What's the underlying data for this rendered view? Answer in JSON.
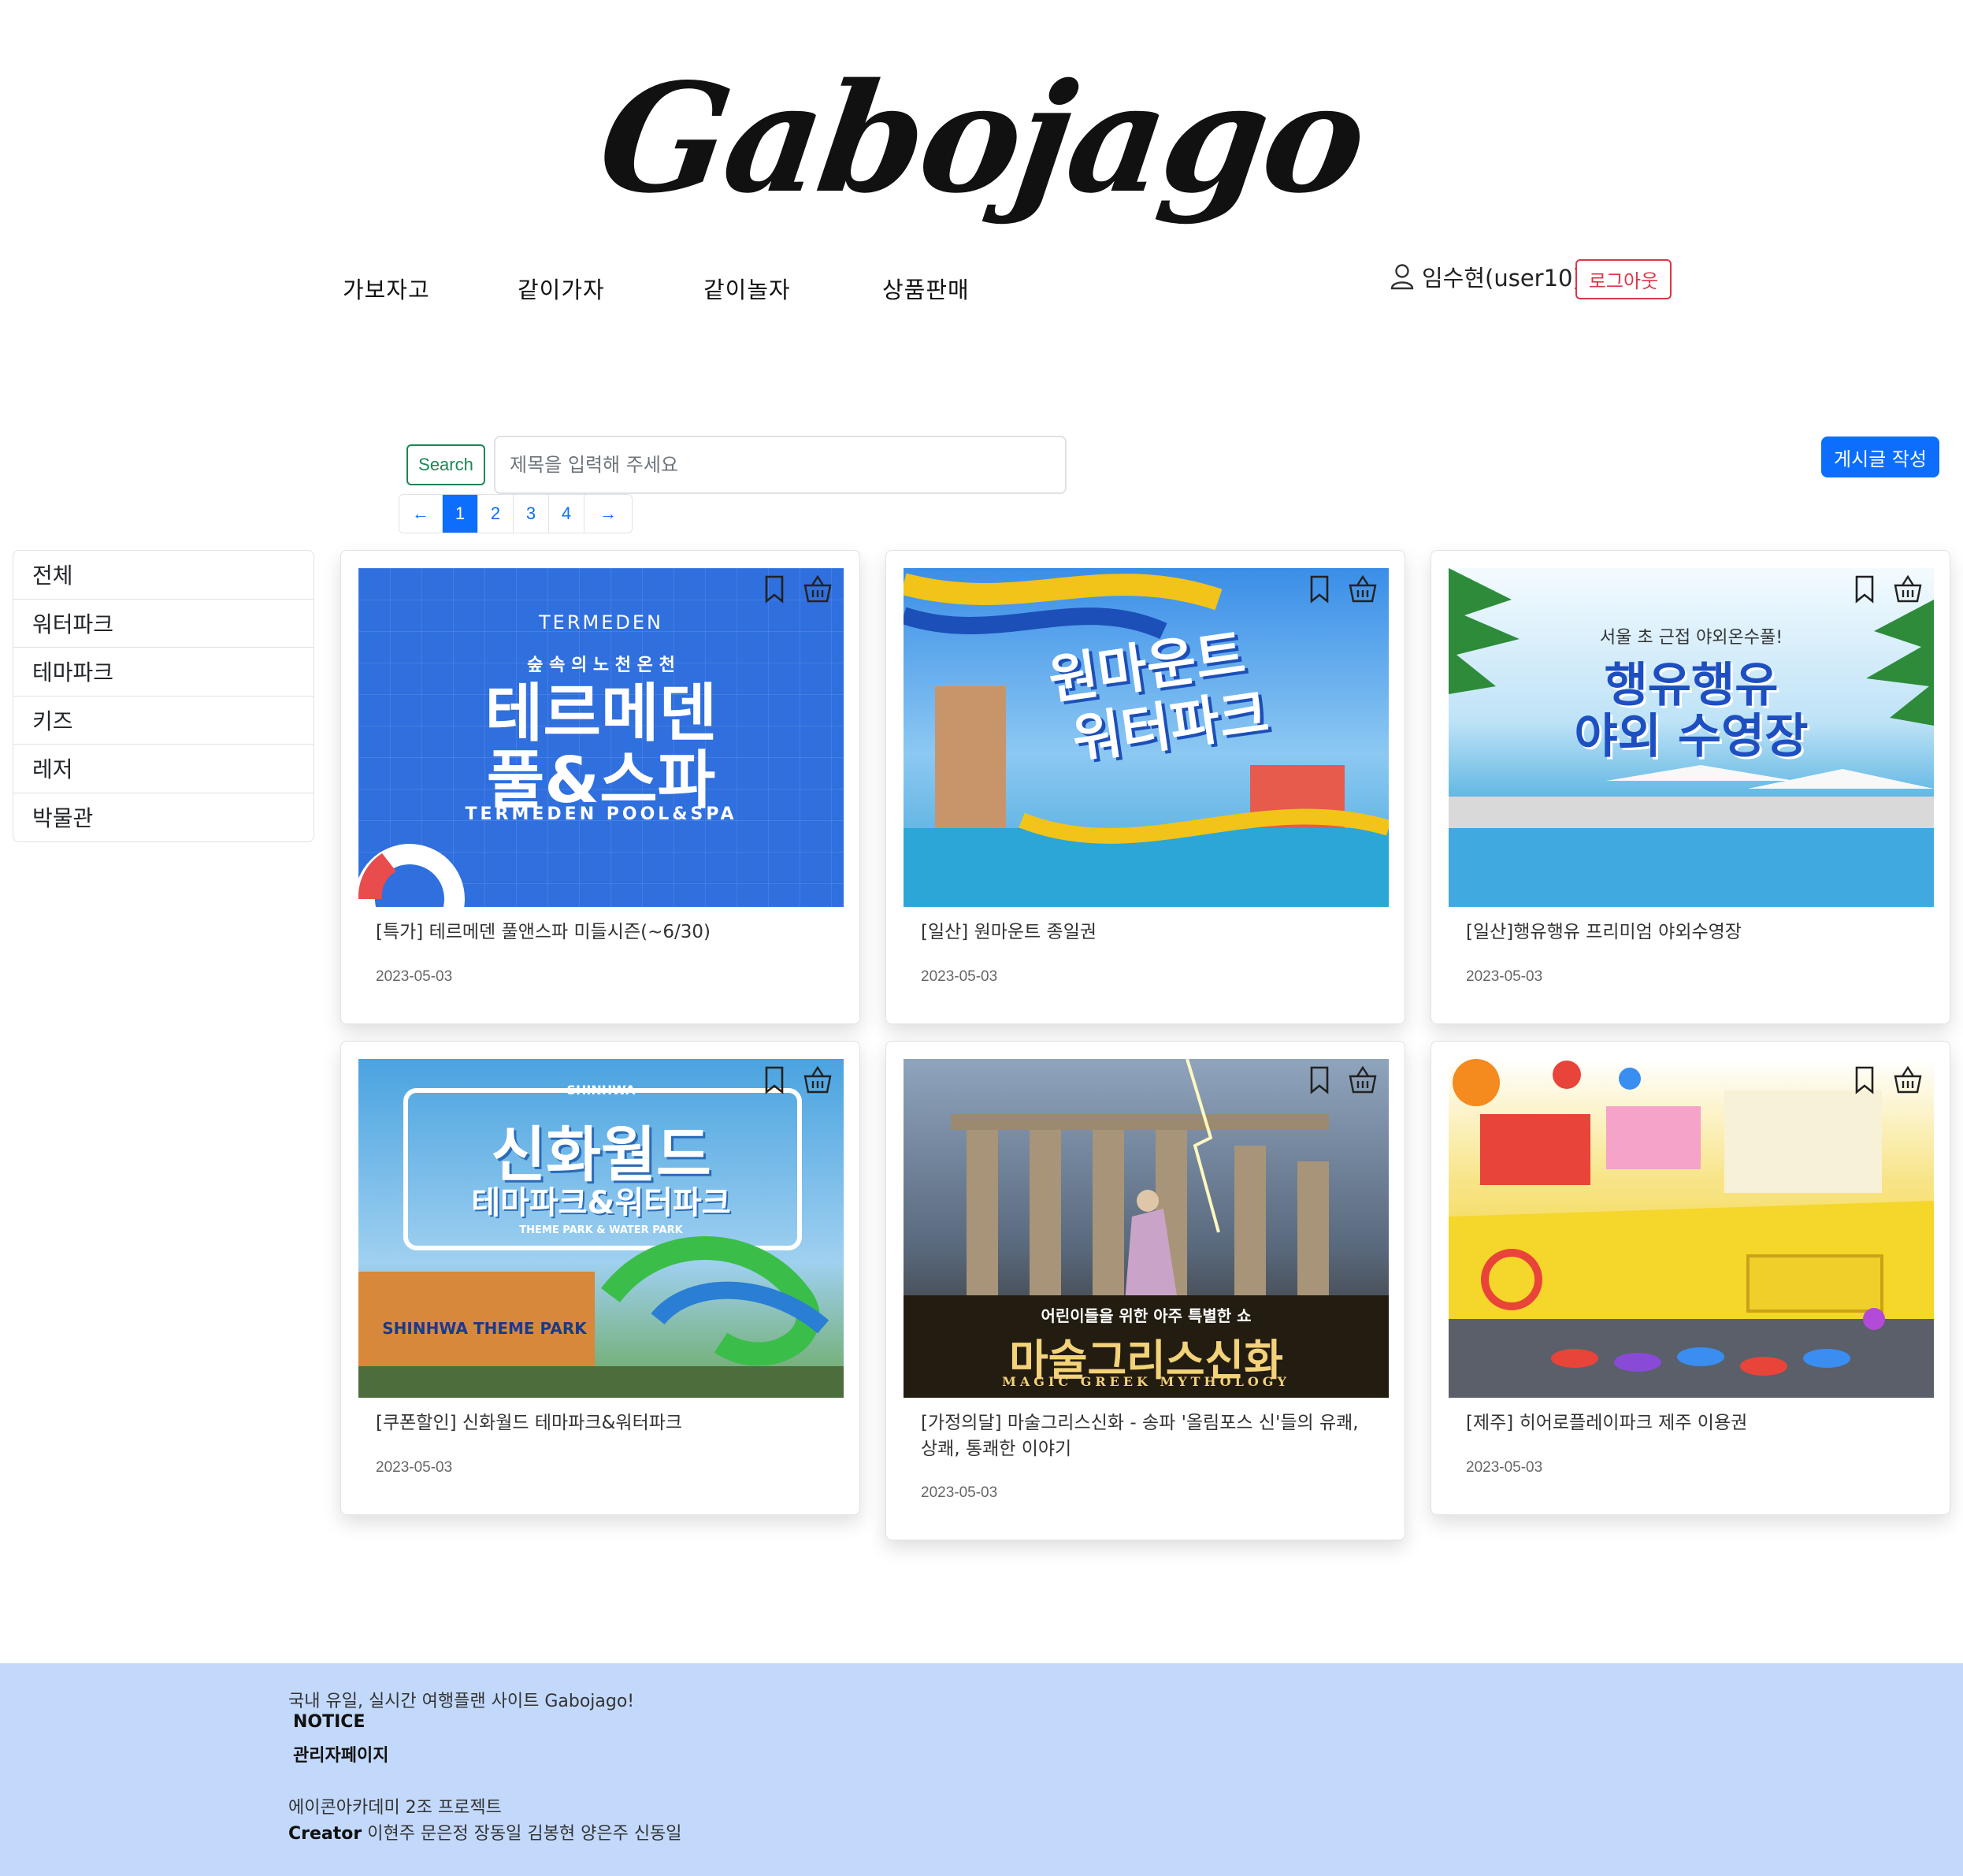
{
  "logo": "Gabojago",
  "nav": {
    "items": [
      "가보자고",
      "같이가자",
      "같이놀자",
      "상품판매"
    ],
    "user_label": "임수현(user10)",
    "logout_label": "로그아웃"
  },
  "search": {
    "button_label": "Search",
    "placeholder": "제목을 입력해 주세요"
  },
  "write_button": "게시글 작성",
  "pagination": {
    "prev": "←",
    "pages": [
      "1",
      "2",
      "3",
      "4"
    ],
    "next": "→",
    "active": "1"
  },
  "categories": [
    "전체",
    "워터파크",
    "테마파크",
    "키즈",
    "레저",
    "박물관"
  ],
  "cards": [
    {
      "title": "[특가] 테르메덴 풀앤스파 미들시즌(~6/30)",
      "date": "2023-05-03",
      "image": {
        "bg": "#2f6fde",
        "text_lines": [
          "TERMEDEN",
          "숲 속 의 노 천 온 천",
          "테르메덴",
          "풀&스파",
          "TERMEDEN POOL&SPA"
        ]
      }
    },
    {
      "title": "[일산] 원마운트 종일권",
      "date": "2023-05-03",
      "image": {
        "bg": "#3a8ee8",
        "text_lines": [
          "원마운트",
          "워터파크"
        ]
      }
    },
    {
      "title": "[일산]행유행유 프리미엄 야외수영장",
      "date": "2023-05-03",
      "image": {
        "bg": "#bfe3f7",
        "text_lines": [
          "서울 초 근접 야외온수풀!",
          "행유행유",
          "야외 수영장"
        ]
      }
    },
    {
      "title": "[쿠폰할인] 신화월드 테마파크&워터파크",
      "date": "2023-05-03",
      "image": {
        "bg": "#4aa3e0",
        "text_lines": [
          "SHINHWA",
          "신화월드",
          "테마파크&워터파크",
          "THEME PARK & WATER PARK",
          "SHINHWA THEME PARK"
        ]
      }
    },
    {
      "title": "[가정의달] 마술그리스신화 - 송파 '올림포스 신'들의 유쾌, 상쾌, 통쾌한 이야기",
      "date": "2023-05-03",
      "image": {
        "bg": "#5a6a7e",
        "text_lines": [
          "어린이들을 위한 아주 특별한 쇼",
          "마술그리스신화",
          "MAGIC GREEK MYTHOLOGY"
        ]
      }
    },
    {
      "title": "[제주] 히어로플레이파크 제주 이용권",
      "date": "2023-05-03",
      "image": {
        "bg": "#f2d23a",
        "text_lines": []
      }
    }
  ],
  "footer": {
    "tagline": "국내 유일, 실시간 여행플랜 사이트 Gabojago!",
    "notice": "NOTICE",
    "admin": "관리자페이지",
    "project": "에이콘아카데미 2조 프로젝트",
    "creator_label": "Creator",
    "creators": "이현주 문은정 장동일 김봉현 양은주 신동일"
  },
  "colors": {
    "primary": "#0d6efd",
    "danger": "#dc3545",
    "success": "#198754",
    "footer_bg": "#c3d9fb"
  }
}
